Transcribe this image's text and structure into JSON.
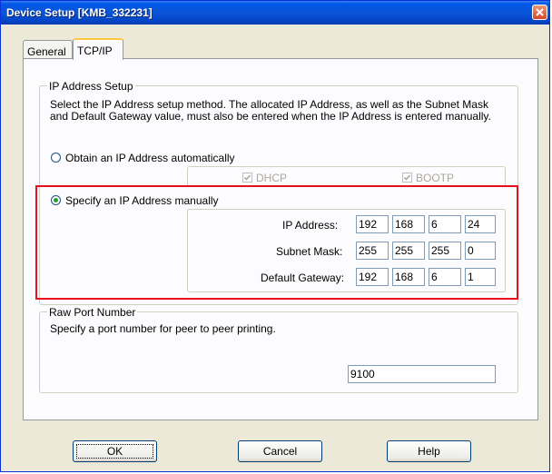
{
  "window": {
    "title": "Device Setup [KMB_332231]"
  },
  "tabs": [
    {
      "label": "General"
    },
    {
      "label": "TCP/IP"
    }
  ],
  "ip_setup": {
    "group_title": "IP Address Setup",
    "description": "Select the IP Address setup method. The allocated IP Address, as well as the Subnet Mask and Default Gateway value, must also be entered when the IP Address is entered manually.",
    "auto_label": "Obtain an IP Address automatically",
    "dhcp_label": "DHCP",
    "bootp_label": "BOOTP",
    "manual_label": "Specify an IP Address manually",
    "ip_address_label": "IP Address:",
    "subnet_mask_label": "Subnet Mask:",
    "gateway_label": "Default Gateway:",
    "ip_address": [
      "192",
      "168",
      "6",
      "24"
    ],
    "subnet_mask": [
      "255",
      "255",
      "255",
      "0"
    ],
    "gateway": [
      "192",
      "168",
      "6",
      "1"
    ]
  },
  "raw_port": {
    "group_title": "Raw Port Number",
    "description": "Specify a port number for peer to peer printing.",
    "value": "9100"
  },
  "buttons": {
    "ok": "OK",
    "cancel": "Cancel",
    "help": "Help"
  },
  "colors": {
    "highlight": "#e8101c",
    "titlebar": "#0058e6"
  }
}
